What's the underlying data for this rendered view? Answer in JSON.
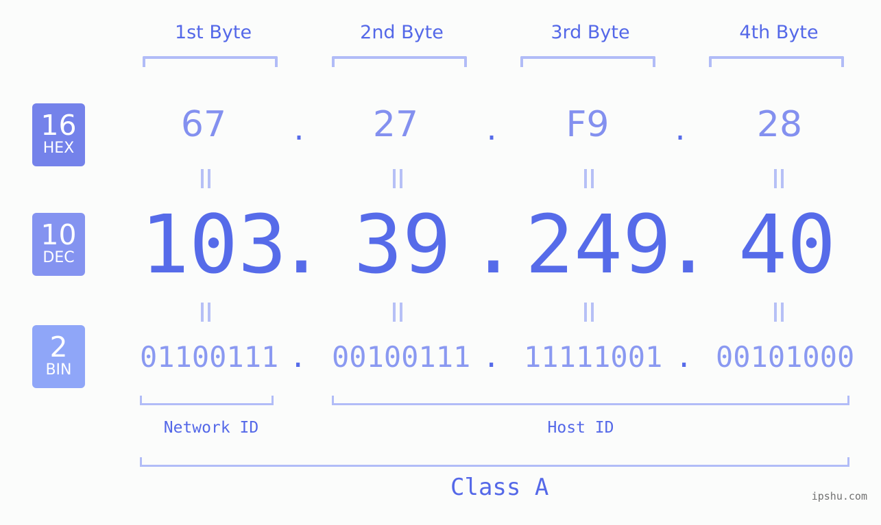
{
  "bytes": {
    "labels": [
      "1st Byte",
      "2nd Byte",
      "3rd Byte",
      "4th Byte"
    ],
    "hex": [
      "67",
      "27",
      "F9",
      "28"
    ],
    "dec": [
      "103",
      "39",
      "249",
      "40"
    ],
    "bin": [
      "01100111",
      "00100111",
      "11111001",
      "00101000"
    ],
    "separator": "."
  },
  "badges": {
    "hex": {
      "num": "16",
      "label": "HEX",
      "color": "#7482ea"
    },
    "dec": {
      "num": "10",
      "label": "DEC",
      "color": "#8493f0"
    },
    "bin": {
      "num": "2",
      "label": "BIN",
      "color": "#8fa6f8"
    }
  },
  "ids": {
    "network": "Network ID",
    "host": "Host ID"
  },
  "class_label": "Class A",
  "footer": "ipshu.com",
  "colors": {
    "accent": "#566be9",
    "bracket": "#b1bcf7",
    "hex_text": "#8390ef",
    "bin_text": "#8a99f1"
  }
}
